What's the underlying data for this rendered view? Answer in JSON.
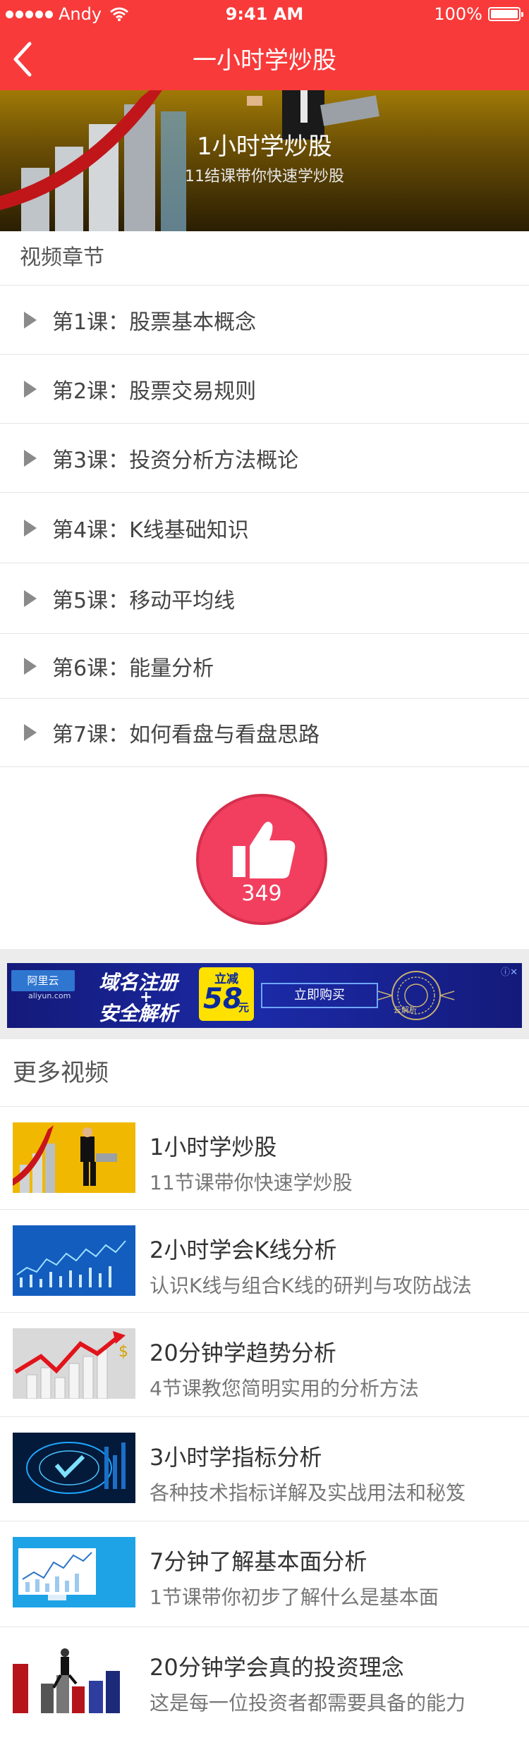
{
  "status": {
    "carrier": "Andy",
    "time": "9:41 AM",
    "battery": "100%"
  },
  "nav": {
    "title": "一小时学炒股"
  },
  "hero": {
    "title": "1小时学炒股",
    "subtitle": "11结课带你快速学炒股"
  },
  "chapters": {
    "heading": "视频章节",
    "items": [
      "第1课：股票基本概念",
      "第2课：股票交易规则",
      "第3课：投资分析方法概论",
      "第4课：K线基础知识",
      "第5课：移动平均线",
      "第6课：能量分析",
      "第7课：如何看盘与看盘思路"
    ]
  },
  "like": {
    "count": "349"
  },
  "ad": {
    "logo": "阿里云",
    "logo_sub": "aliyun.com",
    "line1": "域名注册",
    "plus": "+",
    "line2": "安全解析",
    "badge_top": "立减",
    "badge_num": "58",
    "badge_unit": "元",
    "button": "立即购买",
    "seal_text": "云解析",
    "info": "ⓘ✕"
  },
  "more": {
    "heading": "更多视频",
    "videos": [
      {
        "title": "1小时学炒股",
        "subtitle": "11节课带你快速学炒股"
      },
      {
        "title": "2小时学会K线分析",
        "subtitle": "认识K线与组合K线的研判与攻防战法"
      },
      {
        "title": "20分钟学趋势分析",
        "subtitle": "4节课教您简明实用的分析方法"
      },
      {
        "title": "3小时学指标分析",
        "subtitle": "各种技术指标详解及实战用法和秘笈"
      },
      {
        "title": "7分钟了解基本面分析",
        "subtitle": "1节课带你初步了解什么是基本面"
      },
      {
        "title": "20分钟学会真的投资理念",
        "subtitle": "这是每一位投资者都需要具备的能力"
      }
    ]
  },
  "colors": {
    "nav_red": "#f93a3a",
    "like_red": "#f23f5f",
    "ad_blue": "#1b2aa6"
  }
}
